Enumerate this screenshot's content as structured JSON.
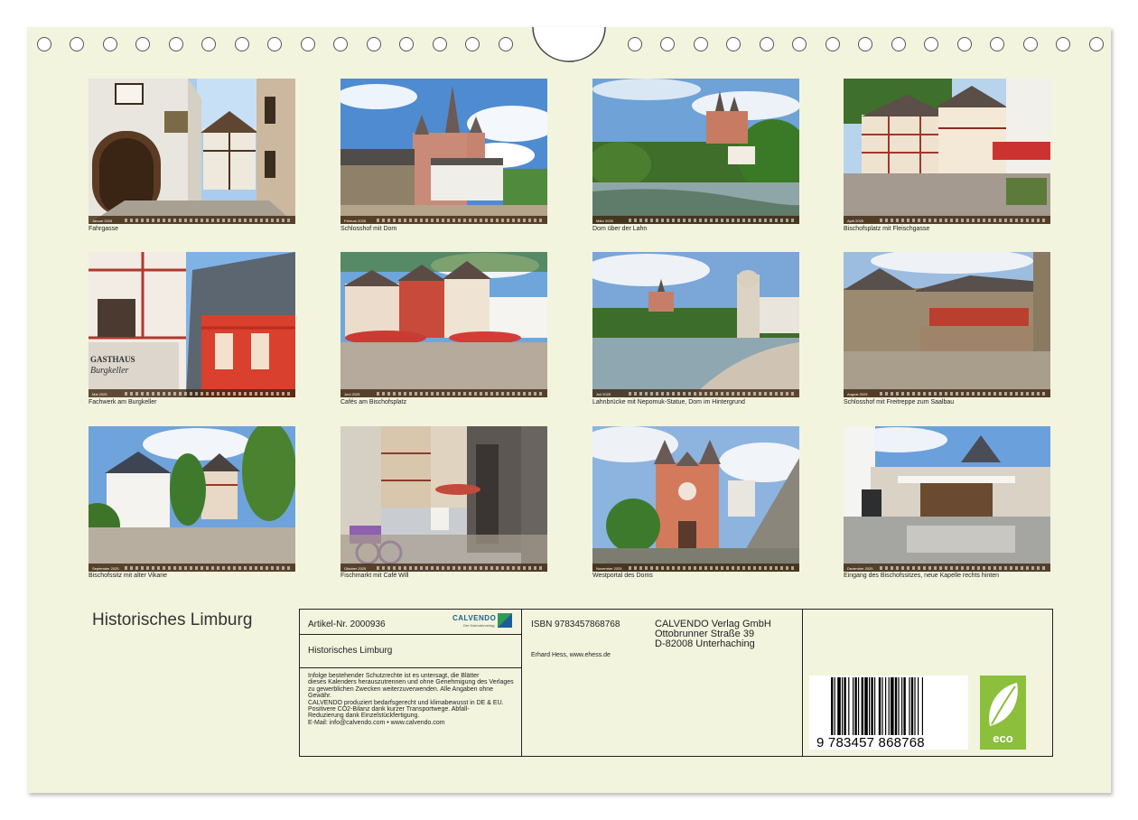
{
  "calendar": {
    "title": "Historisches Limburg",
    "photos": [
      {
        "caption": "Fahrgasse",
        "month": "Januar 2025"
      },
      {
        "caption": "Schlosshof mit Dom",
        "month": "Februar 2025"
      },
      {
        "caption": "Dom über der Lahn",
        "month": "März 2025"
      },
      {
        "caption": "Bischofsplatz mit Fleischgasse",
        "month": "April 2025"
      },
      {
        "caption": "Fachwerk am Burgkeller",
        "month": "Mai 2025"
      },
      {
        "caption": "Cafés am Bischofsplatz",
        "month": "Juni 2025"
      },
      {
        "caption": "Lahnbrücke mit Nepomuk-Statue, Dom im Hintergrund",
        "month": "Juli 2025"
      },
      {
        "caption": "Schlosshof mit Freitreppe zum Saalbau",
        "month": "August 2025"
      },
      {
        "caption": "Bischofssitz mit alter Vikarie",
        "month": "September 2025"
      },
      {
        "caption": "Fischmarkt mit Café Will",
        "month": "Oktober 2025"
      },
      {
        "caption": "Westportal des Doms",
        "month": "November 2025"
      },
      {
        "caption": "Eingang des Bischofssitzes, neue Kapelle rechts hinten",
        "month": "Dezember 2025"
      }
    ],
    "photo_signs": {
      "gasthaus": "GASTHAUS",
      "burgkeller": "Burgkeller"
    }
  },
  "info": {
    "article": "Artikel-Nr. 2000936",
    "product_title": "Historisches Limburg",
    "logo_brand": "CALVENDO",
    "logo_tagline": "Der Kalenderverlag",
    "legal_lines": [
      "Infolge bestehender Schutzrechte ist es untersagt, die Blätter",
      "dieses Kalenders herauszutrennen und ohne Genehmigung des Verlages",
      "zu gewerblichen Zwecken weiterzuverwenden. Alle Angaben ohne",
      "Gewähr.",
      "CALVENDO produziert bedarfsgerecht und klimabewusst in DE & EU.",
      "Positivere CO2-Bilanz dank kurzer Transportwege. Abfall-",
      "Reduzierung dank Einzelstückfertigung.",
      "E-Mail: info@calvendo.com • www.calvendo.com"
    ],
    "isbn": "ISBN 9783457868768",
    "publisher_lines": [
      "CALVENDO Verlag GmbH",
      "Ottobrunner Straße 39",
      "D-82008 Unterhaching"
    ],
    "author": "Erhard Hess, www.ehess.de",
    "barcode_digits": "9 783457 868768",
    "eco_label": "eco"
  },
  "colors": {
    "paper": "#f2f4de",
    "eco_green": "#8bbf3c",
    "calvendo_blue": "#1a5e96"
  }
}
